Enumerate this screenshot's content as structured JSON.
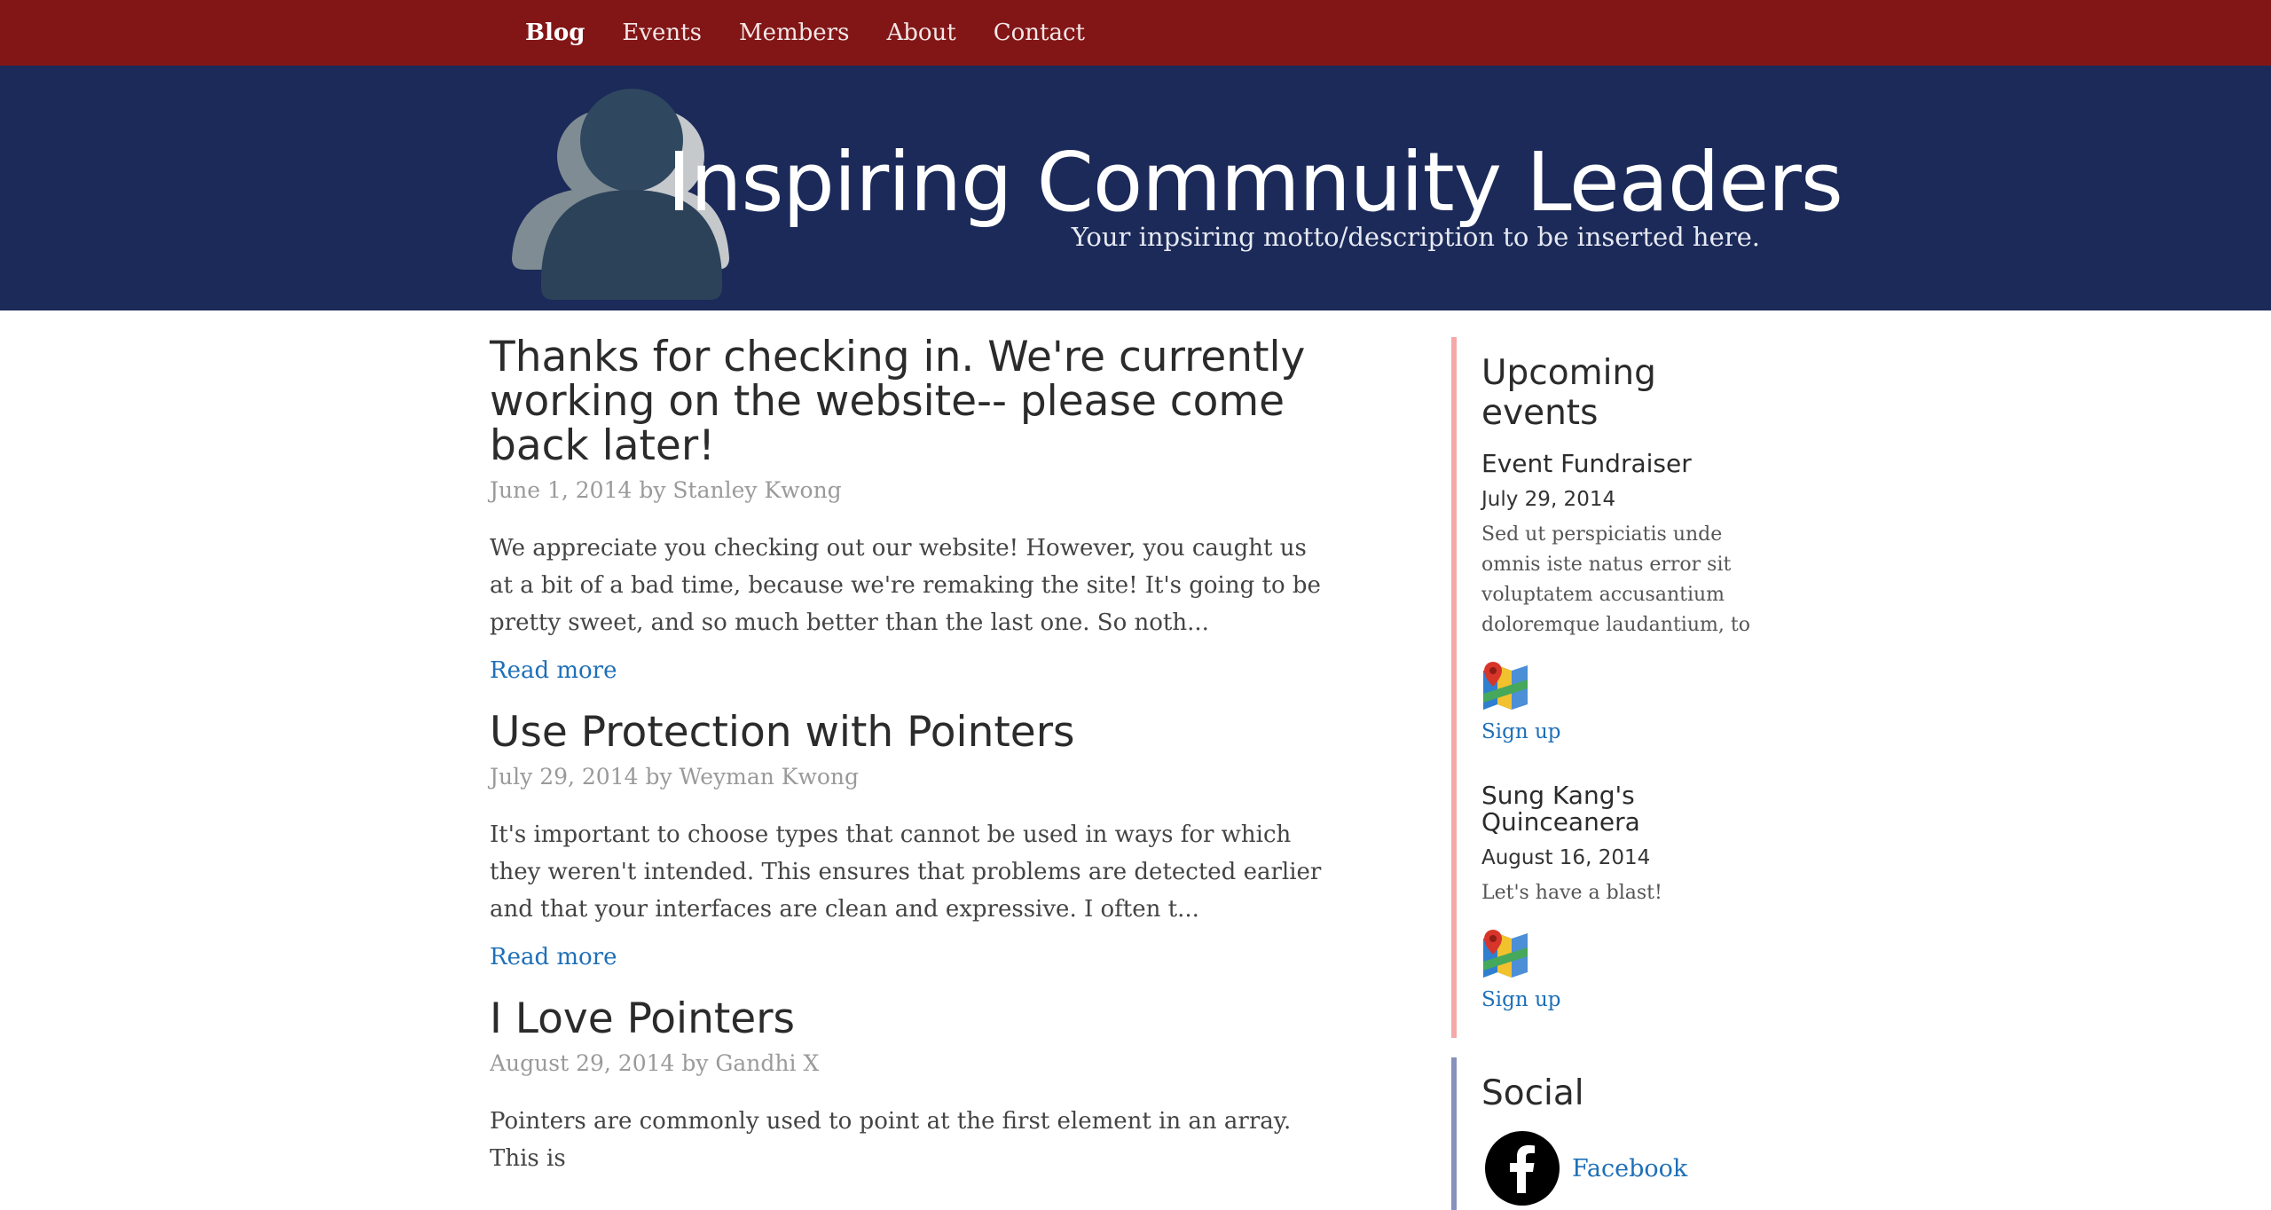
{
  "nav": {
    "items": [
      {
        "label": "Blog",
        "active": true
      },
      {
        "label": "Events",
        "active": false
      },
      {
        "label": "Members",
        "active": false
      },
      {
        "label": "About",
        "active": false
      },
      {
        "label": "Contact",
        "active": false
      }
    ]
  },
  "header": {
    "title": "Inspiring Commnuity Leaders",
    "motto": "Your inpsiring motto/description to be inserted here.",
    "logo_icon": "people-group-icon"
  },
  "posts": [
    {
      "title": "Thanks for checking in. We're currently working on the website-- please come back later!",
      "meta": "June 1, 2014 by Stanley Kwong",
      "excerpt": "We appreciate you checking out our website! However, you caught us at a bit of a bad time, because we're remaking the site! It's going to be pretty sweet, and so much better than the last one. So noth...",
      "read_more": "Read more"
    },
    {
      "title": "Use Protection with Pointers",
      "meta": "July 29, 2014 by Weyman Kwong",
      "excerpt": "It's important to choose types that cannot be used in ways for which they weren't intended. This ensures that problems are detected earlier and that your interfaces are clean and expressive. I often t...",
      "read_more": "Read more"
    },
    {
      "title": "I Love Pointers",
      "meta": "August 29, 2014 by Gandhi X",
      "excerpt": "Pointers are commonly used to point at the first element in an array. This is",
      "read_more": ""
    }
  ],
  "sidebar": {
    "events_heading": "Upcoming events",
    "events": [
      {
        "title": "Event Fundraiser",
        "date": "July 29, 2014",
        "description": "Sed ut perspiciatis unde omnis iste natus error sit voluptatem accusantium doloremque laudantium, to",
        "signup": "Sign up",
        "map_icon": "map-pin-icon"
      },
      {
        "title": "Sung Kang's Quinceanera",
        "date": "August 16, 2014",
        "description": "Let's have a blast!",
        "signup": "Sign up",
        "map_icon": "map-pin-icon"
      }
    ],
    "social_heading": "Social",
    "social": [
      {
        "label": "Facebook",
        "icon": "facebook-icon"
      }
    ]
  },
  "colors": {
    "nav_bg": "#821617",
    "banner_bg": "#1b2a59",
    "link": "#1e6fb8",
    "events_border": "#f4a9a8",
    "social_border": "#8791bd"
  }
}
